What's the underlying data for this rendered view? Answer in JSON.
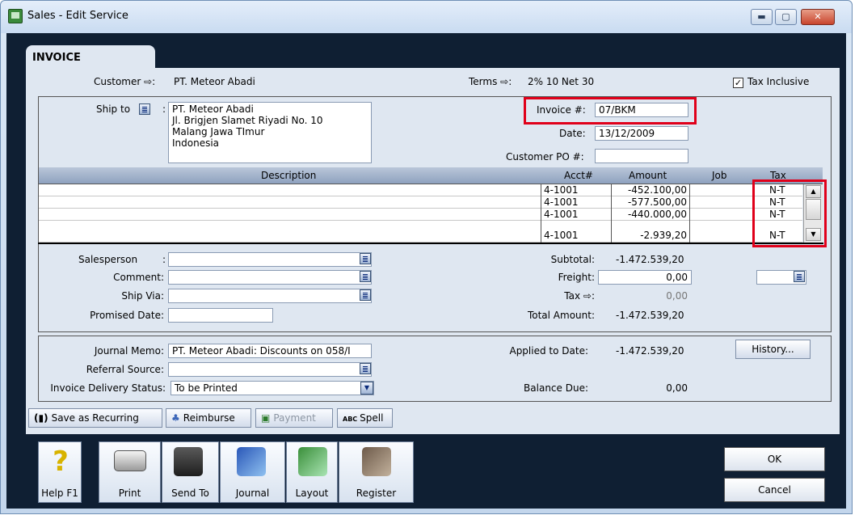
{
  "window": {
    "title": "Sales - Edit Service",
    "min": "▬",
    "max": "▢",
    "close": "✕"
  },
  "tab": "INVOICE",
  "header": {
    "customer_label": "Customer ⇨:",
    "customer": "PT. Meteor Abadi",
    "terms_label": "Terms ⇨:",
    "terms": "2% 10 Net 30",
    "tax_inclusive": "Tax Inclusive",
    "tax_inclusive_checked": true
  },
  "ship": {
    "label": "Ship to",
    "colon": ":",
    "lines": [
      "PT. Meteor Abadi",
      "Jl. Brigjen Slamet Riyadi No. 10",
      "Malang  Jawa TImur",
      "Indonesia"
    ]
  },
  "invoice": {
    "number_label": "Invoice #:",
    "number": "07/BKM",
    "date_label": "Date:",
    "date": "13/12/2009",
    "po_label": "Customer PO #:",
    "po": ""
  },
  "table": {
    "headers": {
      "description": "Description",
      "acct": "Acct#",
      "amount": "Amount",
      "job": "Job",
      "tax": "Tax"
    },
    "rows": [
      {
        "acct": "4-1001",
        "amount": "-452.100,00",
        "tax": "N-T"
      },
      {
        "acct": "4-1001",
        "amount": "-577.500,00",
        "tax": "N-T"
      },
      {
        "acct": "4-1001",
        "amount": "-440.000,00",
        "tax": "N-T"
      },
      {
        "acct": "4-1001",
        "amount": "-2.939,20",
        "tax": "N-T"
      }
    ]
  },
  "left_fields": {
    "salesperson": "Salesperson",
    "salesperson_colon": ":",
    "comment": "Comment:",
    "ship_via": "Ship Via:",
    "promised": "Promised Date:"
  },
  "totals": {
    "subtotal_label": "Subtotal:",
    "subtotal": "-1.472.539,20",
    "freight_label": "Freight:",
    "freight": "0,00",
    "tax_label": "Tax ⇨:",
    "tax": "0,00",
    "total_label": "Total Amount:",
    "total": "-1.472.539,20"
  },
  "lower": {
    "memo_label": "Journal Memo:",
    "memo": "PT. Meteor Abadi:  Discounts on 058/I",
    "referral_label": "Referral Source:",
    "referral": "",
    "delivery_label": "Invoice Delivery Status:",
    "delivery": "To be Printed",
    "applied_label": "Applied to Date:",
    "applied": "-1.472.539,20",
    "balance_label": "Balance Due:",
    "balance": "0,00",
    "history": "History..."
  },
  "toolbar": {
    "recurring": "Save as Recurring",
    "reimburse": "Reimburse",
    "payment": "Payment",
    "spell": "Spell"
  },
  "bottom": {
    "help": "Help F1",
    "print": "Print",
    "send": "Send To",
    "journal": "Journal",
    "layout": "Layout",
    "register": "Register",
    "ok": "OK",
    "cancel": "Cancel"
  }
}
